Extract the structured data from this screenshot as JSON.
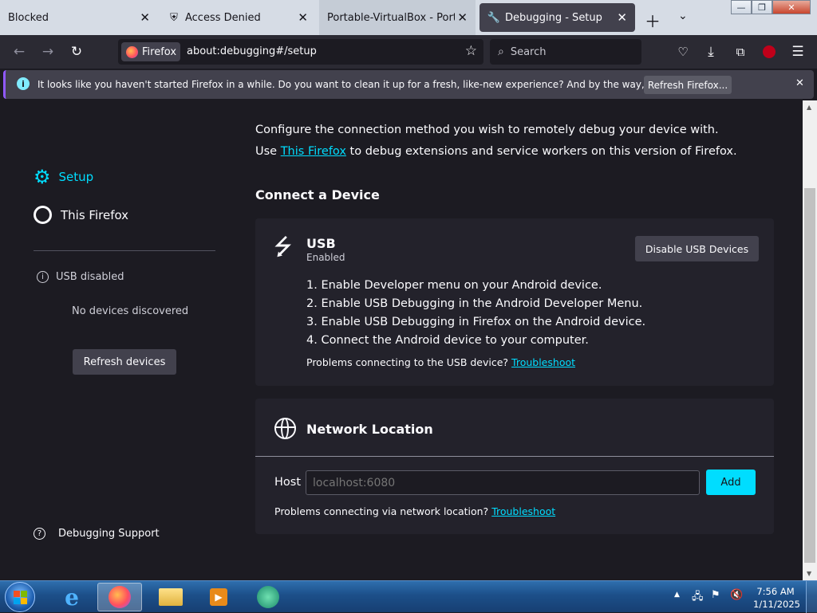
{
  "browser": {
    "tabs": [
      {
        "label": "Blocked"
      },
      {
        "label": "Access Denied"
      },
      {
        "label": "Portable-VirtualBox - Portable"
      },
      {
        "label": "Debugging - Setup"
      }
    ],
    "identity_label": "Firefox",
    "url": "about:debugging#/setup",
    "search_placeholder": "Search",
    "notification": {
      "text": "It looks like you haven't started Firefox in a while. Do you want to clean it up for a fresh, like-new experience? And by the way, welcome back!",
      "button": "Refresh Firefox..."
    }
  },
  "sidebar": {
    "setup": "Setup",
    "this_firefox": "This Firefox",
    "usb_status": "USB disabled",
    "no_devices": "No devices discovered",
    "refresh": "Refresh devices",
    "support": "Debugging Support"
  },
  "main": {
    "intro1": "Configure the connection method you wish to remotely debug your device with.",
    "intro2_pre": "Use",
    "intro2_link": "This Firefox",
    "intro2_post": "to debug extensions and service workers on this version of Firefox.",
    "connect_heading": "Connect a Device",
    "usb": {
      "title": "USB",
      "status": "Enabled",
      "button": "Disable USB Devices",
      "steps": [
        "1.  Enable Developer menu on your Android device.",
        "2.  Enable USB Debugging in the Android Developer Menu.",
        "3.  Enable USB Debugging in Firefox on the Android device.",
        "4.  Connect the Android device to your computer."
      ],
      "problem_text": "Problems connecting to the USB device?",
      "troubleshoot": "Troubleshoot"
    },
    "network": {
      "title": "Network Location",
      "host_label": "Host",
      "host_placeholder": "localhost:6080",
      "add": "Add",
      "problem_text": "Problems connecting via network location?",
      "troubleshoot": "Troubleshoot"
    }
  },
  "taskbar": {
    "time": "7:56 AM",
    "date": "1/11/2025"
  },
  "colors": {
    "accent": "#00ddff",
    "background": "#1c1b22",
    "card": "#23222b"
  }
}
